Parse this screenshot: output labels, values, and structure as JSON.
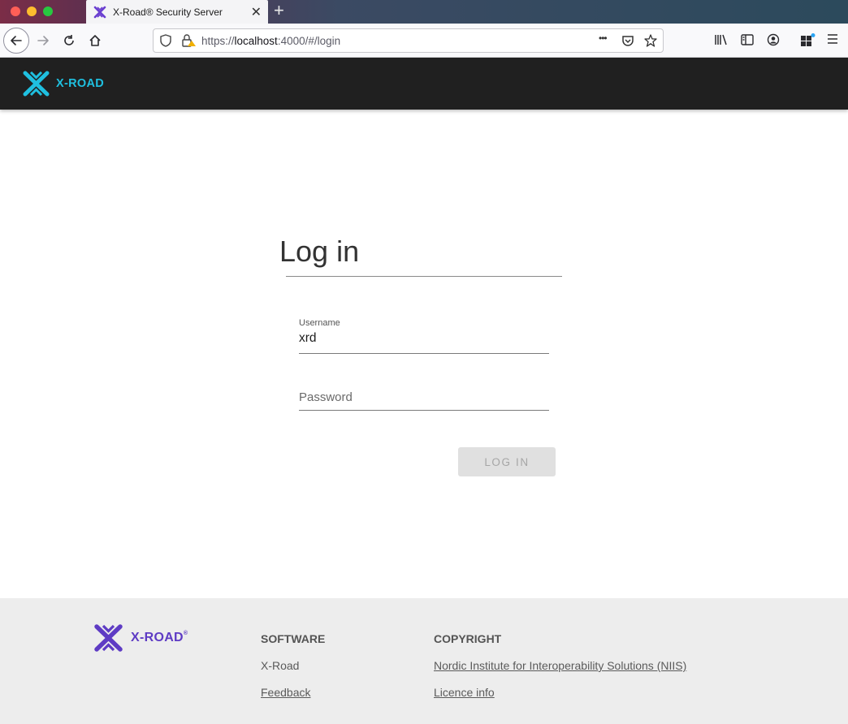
{
  "browser": {
    "tab_title": "X-Road® Security Server",
    "new_tab_symbol": "+",
    "close_symbol": "✕",
    "url_prefix": "https://",
    "url_host": "localhost",
    "url_rest": ":4000/#/login",
    "more_symbol": "•••"
  },
  "header": {
    "brand": "X-ROAD",
    "accent_color": "#1fc0e0"
  },
  "login": {
    "title": "Log in",
    "username_label": "Username",
    "username_value": "xrd",
    "password_placeholder": "Password",
    "button_label": "LOG IN"
  },
  "footer": {
    "brand": "X-ROAD",
    "brand_mark": "®",
    "brand_color": "#5e3bc4",
    "software_heading": "SOFTWARE",
    "software_links": [
      "X-Road",
      "Feedback"
    ],
    "copyright_heading": "COPYRIGHT",
    "copyright_links": [
      "Nordic Institute for Interoperability Solutions (NIIS)",
      "Licence info"
    ]
  }
}
